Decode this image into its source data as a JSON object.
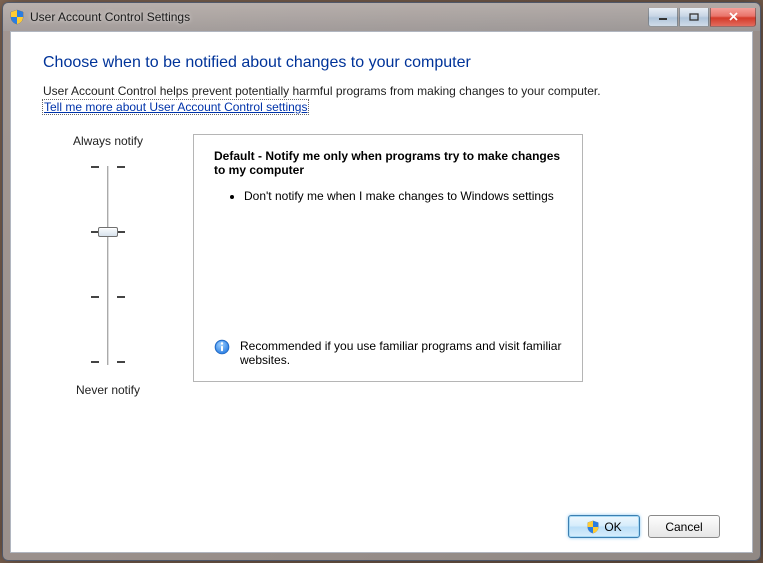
{
  "window": {
    "title": "User Account Control Settings"
  },
  "heading": "Choose when to be notified about changes to your computer",
  "intro": "User Account Control helps prevent potentially harmful programs from making changes to your computer.",
  "linkText": "Tell me more about User Account Control settings",
  "slider": {
    "topLabel": "Always notify",
    "bottomLabel": "Never notify"
  },
  "description": {
    "title": "Default - Notify me only when programs try to make changes to my computer",
    "bullet1": "Don't notify me when I make changes to Windows settings",
    "recommendation": "Recommended if you use familiar programs and visit familiar websites."
  },
  "buttons": {
    "ok": "OK",
    "cancel": "Cancel"
  }
}
